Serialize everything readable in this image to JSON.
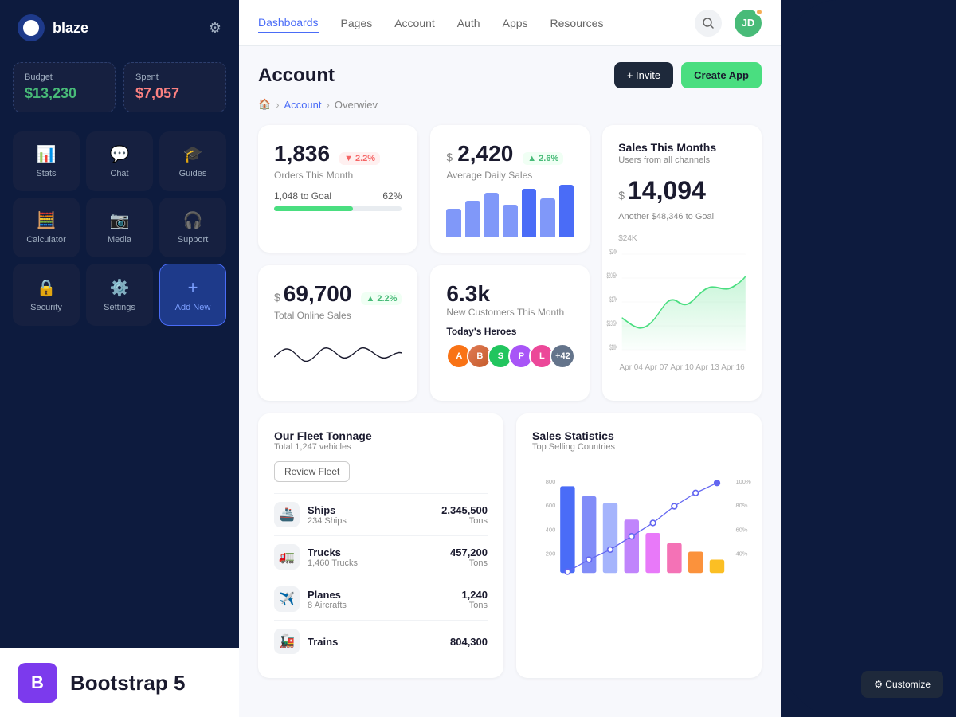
{
  "app": {
    "name": "blaze"
  },
  "sidebar": {
    "budget_label": "Budget",
    "budget_value": "$13,230",
    "spent_label": "Spent",
    "spent_value": "$7,057",
    "nav_items": [
      {
        "id": "stats",
        "label": "Stats",
        "icon": "📊"
      },
      {
        "id": "chat",
        "label": "Chat",
        "icon": "💬"
      },
      {
        "id": "guides",
        "label": "Guides",
        "icon": "🎓"
      },
      {
        "id": "calculator",
        "label": "Calculator",
        "icon": "🧮"
      },
      {
        "id": "media",
        "label": "Media",
        "icon": "📷"
      },
      {
        "id": "support",
        "label": "Support",
        "icon": "🎧"
      },
      {
        "id": "security",
        "label": "Security",
        "icon": "🔒"
      },
      {
        "id": "settings",
        "label": "Settings",
        "icon": "⚙️"
      },
      {
        "id": "add-new",
        "label": "Add New",
        "icon": "+"
      }
    ],
    "bootstrap_label": "Bootstrap 5"
  },
  "topnav": {
    "links": [
      {
        "id": "dashboards",
        "label": "Dashboards",
        "active": true
      },
      {
        "id": "pages",
        "label": "Pages"
      },
      {
        "id": "account",
        "label": "Account"
      },
      {
        "id": "auth",
        "label": "Auth"
      },
      {
        "id": "apps",
        "label": "Apps"
      },
      {
        "id": "resources",
        "label": "Resources"
      }
    ]
  },
  "page": {
    "title": "Account",
    "breadcrumbs": [
      "🏠",
      "Account",
      "Overwiev"
    ],
    "invite_label": "+ Invite",
    "create_app_label": "Create App"
  },
  "stats": {
    "orders": {
      "value": "1,836",
      "label": "Orders This Month",
      "change": "2.2%",
      "change_dir": "down",
      "goal_label": "1,048 to Goal",
      "goal_pct": "62%",
      "progress": 62
    },
    "daily_sales": {
      "prefix": "$",
      "value": "2,420",
      "label": "Average Daily Sales",
      "change": "2.6%",
      "change_dir": "up"
    },
    "sales_month": {
      "title": "Sales This Months",
      "subtitle": "Users from all channels",
      "prefix": "$",
      "value": "14,094",
      "goal_text": "Another $48,346 to Goal",
      "y_labels": [
        "$24K",
        "$20.5K",
        "$17K",
        "$13.5K",
        "$10K"
      ],
      "x_labels": [
        "Apr 04",
        "Apr 07",
        "Apr 10",
        "Apr 13",
        "Apr 16"
      ]
    },
    "online_sales": {
      "prefix": "$",
      "value": "69,700",
      "change": "2.2%",
      "change_dir": "up",
      "label": "Total Online Sales"
    },
    "new_customers": {
      "value": "6.3k",
      "label": "New Customers This Month",
      "heroes_title": "Today's Heroes",
      "heroes_count": "+42"
    }
  },
  "fleet": {
    "title": "Our Fleet Tonnage",
    "subtitle": "Total 1,247 vehicles",
    "review_btn": "Review Fleet",
    "items": [
      {
        "icon": "🚢",
        "name": "Ships",
        "sub": "234 Ships",
        "value": "2,345,500",
        "unit": "Tons"
      },
      {
        "icon": "🚛",
        "name": "Trucks",
        "sub": "1,460 Trucks",
        "value": "457,200",
        "unit": "Tons"
      },
      {
        "icon": "✈️",
        "name": "Planes",
        "sub": "8 Aircrafts",
        "value": "1,240",
        "unit": "Tons"
      },
      {
        "icon": "🚂",
        "name": "Trains",
        "sub": "",
        "value": "804,300",
        "unit": ""
      }
    ]
  },
  "sales_stats": {
    "title": "Sales Statistics",
    "subtitle": "Top Selling Countries"
  },
  "customize_label": "⚙ Customize"
}
